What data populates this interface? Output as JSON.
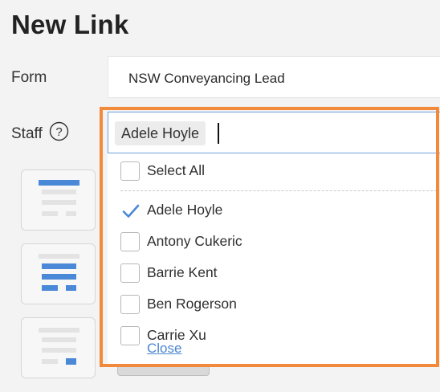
{
  "page": {
    "title": "New Link"
  },
  "form": {
    "label": "Form",
    "value": "NSW Conveyancing Lead"
  },
  "staff": {
    "label": "Staff",
    "help_icon": "question-circle-icon",
    "selected_chip": "Adele Hoyle",
    "select_all_label": "Select All",
    "options": [
      {
        "label": "Adele Hoyle",
        "checked": true
      },
      {
        "label": "Antony Cukeric",
        "checked": false
      },
      {
        "label": "Barrie Kent",
        "checked": false
      },
      {
        "label": "Ben Rogerson",
        "checked": false
      },
      {
        "label": "Carrie Xu",
        "checked": false
      }
    ],
    "close_label": "Close"
  },
  "layout_cards": [
    {
      "icon": "layout-top-aligned-icon"
    },
    {
      "icon": "layout-center-aligned-icon"
    },
    {
      "icon": "layout-bottom-right-icon"
    }
  ],
  "colors": {
    "highlight": "#f28a3c",
    "accent": "#4a88d8",
    "link": "#4b86d0"
  }
}
